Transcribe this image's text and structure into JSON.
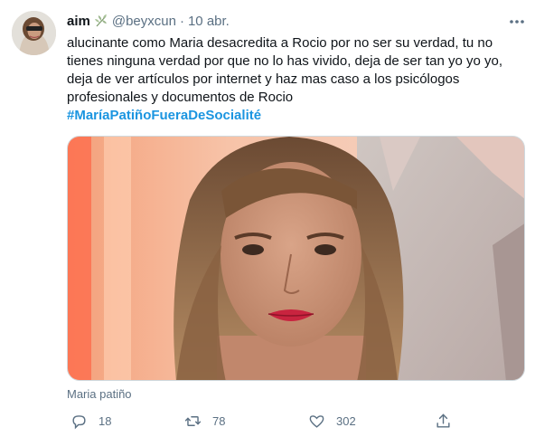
{
  "author": {
    "name": "aim",
    "handle": "@beyxcun",
    "separator": "·",
    "date": "10 abr.",
    "name_emoji": "leaf-emoji-icon"
  },
  "tweet": {
    "lines": [
      "alucinante como Maria desacredita a Rocio por no ser su verdad, tu no",
      "tienes ninguna verdad por que no lo has vivido, deja de ser tan yo yo yo,",
      "deja de ver artículos por internet y haz mas caso a los psicólogos",
      "profesionales y documentos de Rocio"
    ],
    "hashtag": "#MaríaPatiñoFueraDeSocialité"
  },
  "media": {
    "caption": "Maria patiño"
  },
  "actions": {
    "replies": "18",
    "retweets": "78",
    "likes": "302",
    "share_icon": "share-icon"
  },
  "colors": {
    "text": "#0f1419",
    "secondary": "#5b7083",
    "link": "#1b95e0"
  }
}
